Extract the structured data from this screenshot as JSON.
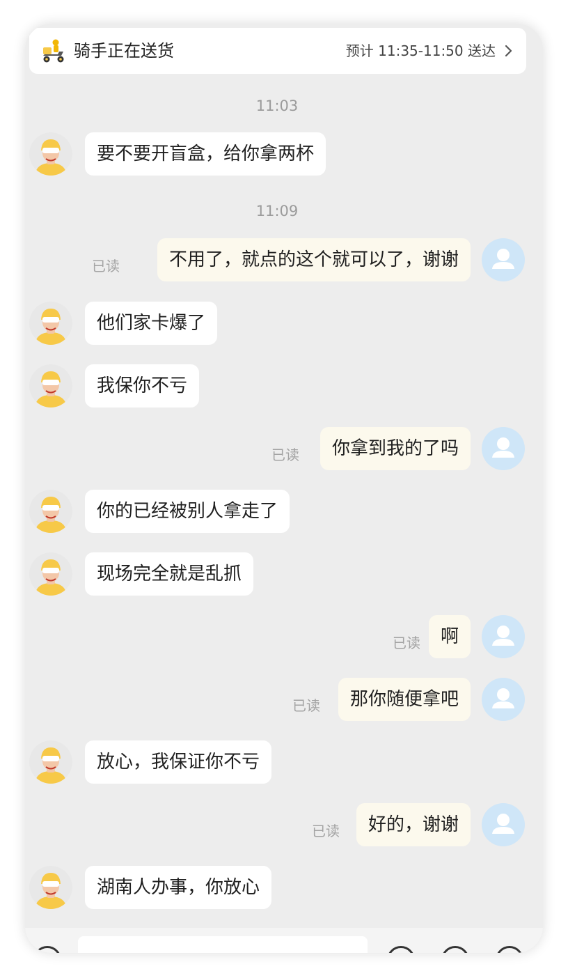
{
  "header": {
    "status": "骑手正在送货",
    "eta": "预计 11:35-11:50 送达"
  },
  "timestamps": [
    "11:03",
    "11:09"
  ],
  "read_label": "已读",
  "messages": [
    {
      "side": "rider",
      "text": "要不要开盲盒，给你拿两杯"
    },
    {
      "side": "user",
      "text": "不用了，就点的这个就可以了，谢谢",
      "read": true
    },
    {
      "side": "rider",
      "text": "他们家卡爆了"
    },
    {
      "side": "rider",
      "text": "我保你不亏"
    },
    {
      "side": "user",
      "text": "你拿到我的了吗",
      "read": true
    },
    {
      "side": "rider",
      "text": "你的已经被别人拿走了"
    },
    {
      "side": "rider",
      "text": "现场完全就是乱抓"
    },
    {
      "side": "user",
      "text": "啊",
      "read": true
    },
    {
      "side": "user",
      "text": "那你随便拿吧",
      "read": true
    },
    {
      "side": "rider",
      "text": "放心，我保证你不亏"
    },
    {
      "side": "user",
      "text": "好的，谢谢",
      "read": true
    },
    {
      "side": "rider",
      "text": "湖南人办事，你放心"
    }
  ],
  "colors": {
    "rider_helmet": "#f7c948",
    "user_avatar_bg": "#cfe6f8",
    "user_bubble": "#fcf9ed",
    "chat_bg": "#ededed"
  },
  "icons": {
    "header_left": "delivery-scooter-icon",
    "header_right": "chevron-right-icon",
    "rider_avatar": "rider-helmet-avatar",
    "user_avatar": "user-silhouette-icon"
  }
}
